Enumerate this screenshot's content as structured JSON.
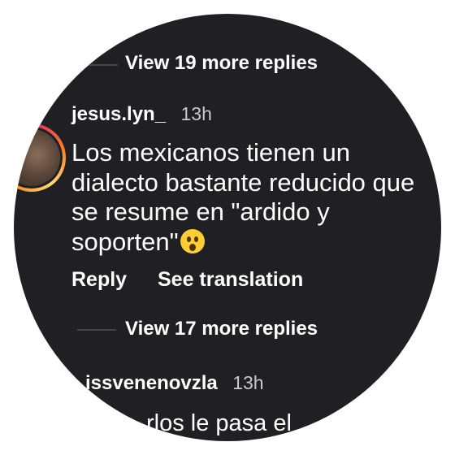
{
  "thread": {
    "view_more_top": "View 19 more replies",
    "view_more_bottom": "View 17 more replies"
  },
  "comment": {
    "username": "jesus.lyn_",
    "time": "13h",
    "text": "Los mexicanos tienen un dialecto bastante reducido que se resume en \"ardido y soporten\"",
    "emoji": "hushed-face-emoji",
    "reply_label": "Reply",
    "translate_label": "See translation"
  },
  "next_comment": {
    "username_partial": "issvenenovzla",
    "time": "13h",
    "text_partial": "rlos le pasa el"
  }
}
